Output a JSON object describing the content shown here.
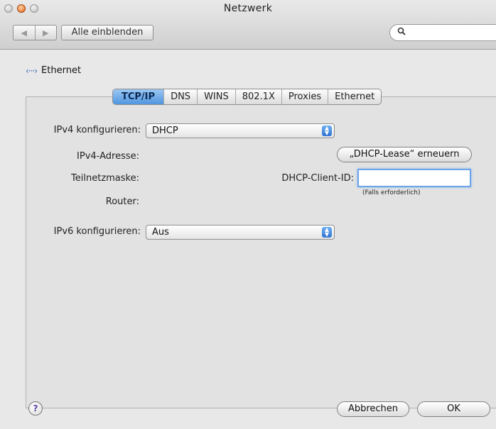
{
  "window": {
    "title": "Netzwerk"
  },
  "toolbar": {
    "back_glyph": "◀",
    "forward_glyph": "▶",
    "show_all_label": "Alle einblenden",
    "search_glyph": "🔍"
  },
  "interface": {
    "icon_glyph": "‹···›",
    "name": "Ethernet"
  },
  "tabs": [
    {
      "label": "TCP/IP",
      "active": true
    },
    {
      "label": "DNS"
    },
    {
      "label": "WINS"
    },
    {
      "label": "802.1X"
    },
    {
      "label": "Proxies"
    },
    {
      "label": "Ethernet"
    }
  ],
  "form": {
    "ipv4_config_label": "IPv4 konfigurieren:",
    "ipv4_config_value": "DHCP",
    "ipv4_address_label": "IPv4-Adresse:",
    "subnet_mask_label": "Teilnetzmaske:",
    "router_label": "Router:",
    "renew_dhcp_label": "„DHCP-Lease“ erneuern",
    "dhcp_client_id_label": "DHCP-Client-ID:",
    "dhcp_client_id_value": "",
    "dhcp_client_id_hint": "(Falls erforderlich)",
    "ipv6_config_label": "IPv6 konfigurieren:",
    "ipv6_config_value": "Aus"
  },
  "footer": {
    "help_glyph": "?",
    "cancel_label": "Abbrechen",
    "ok_label": "OK"
  }
}
